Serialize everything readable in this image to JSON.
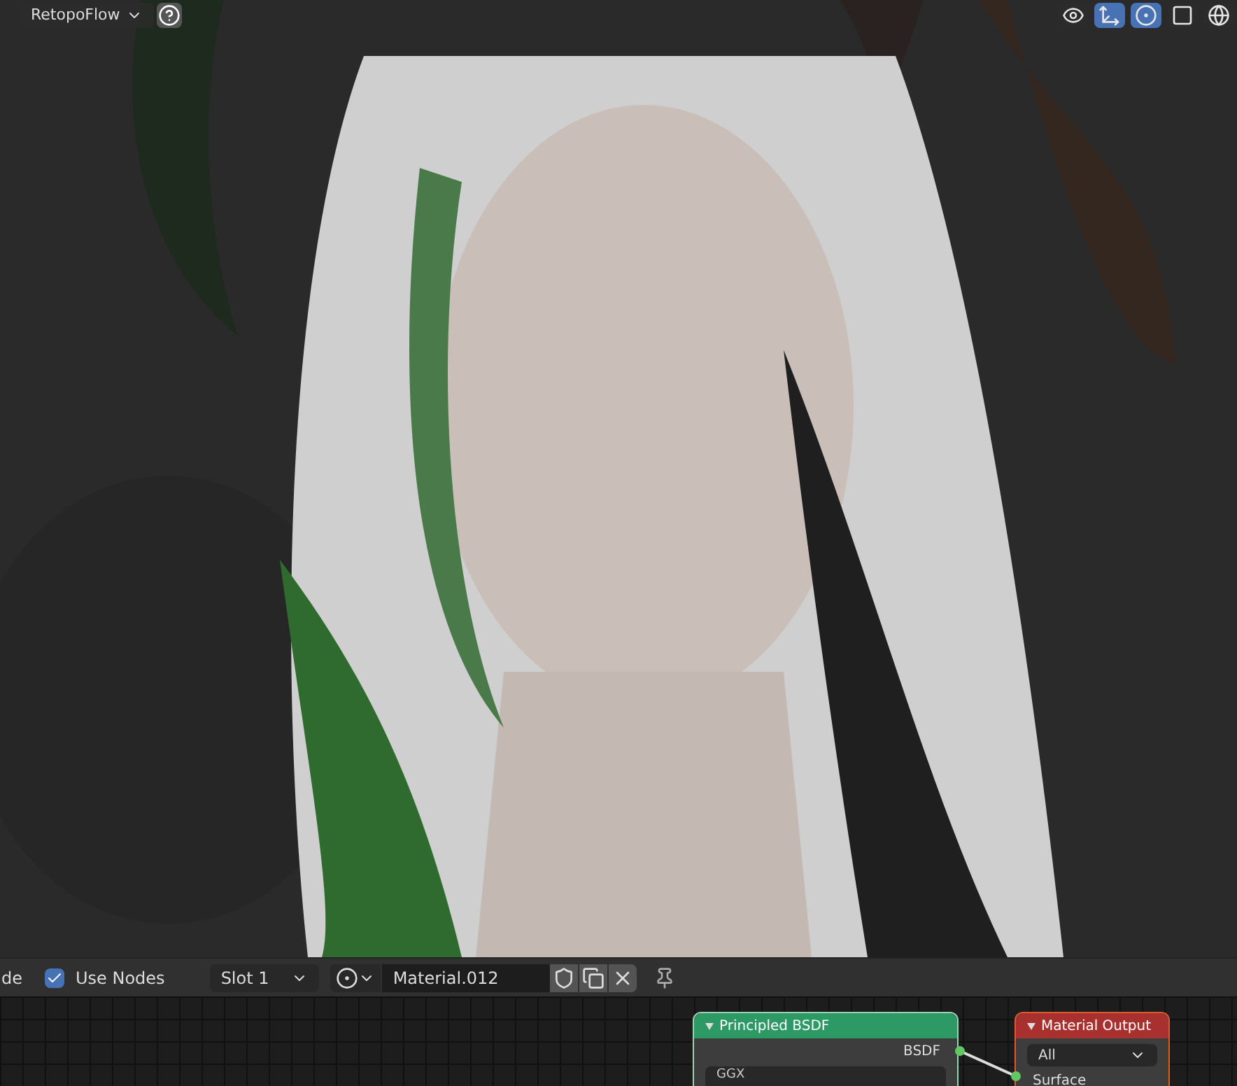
{
  "viewport": {
    "addon_menu": {
      "label": "RetopoFlow"
    },
    "header_toggles": [
      {
        "kind": "visibility",
        "selected": false
      },
      {
        "kind": "gizmo",
        "selected": true
      },
      {
        "kind": "overlay",
        "selected": true
      },
      {
        "kind": "xray",
        "selected": false
      },
      {
        "kind": "shading",
        "selected": false
      }
    ]
  },
  "node_header": {
    "mode_cut": "de",
    "use_nodes": {
      "label": "Use Nodes",
      "checked": true
    },
    "slot": "Slot 1",
    "material": "Material.012"
  },
  "nodes": [
    {
      "kind": "bsdf",
      "title": "Principled BSDF",
      "output": "BSDF",
      "dropdown": "GGX"
    },
    {
      "kind": "output",
      "title": "Material Output",
      "dropdown": "All",
      "input": "Surface"
    }
  ]
}
